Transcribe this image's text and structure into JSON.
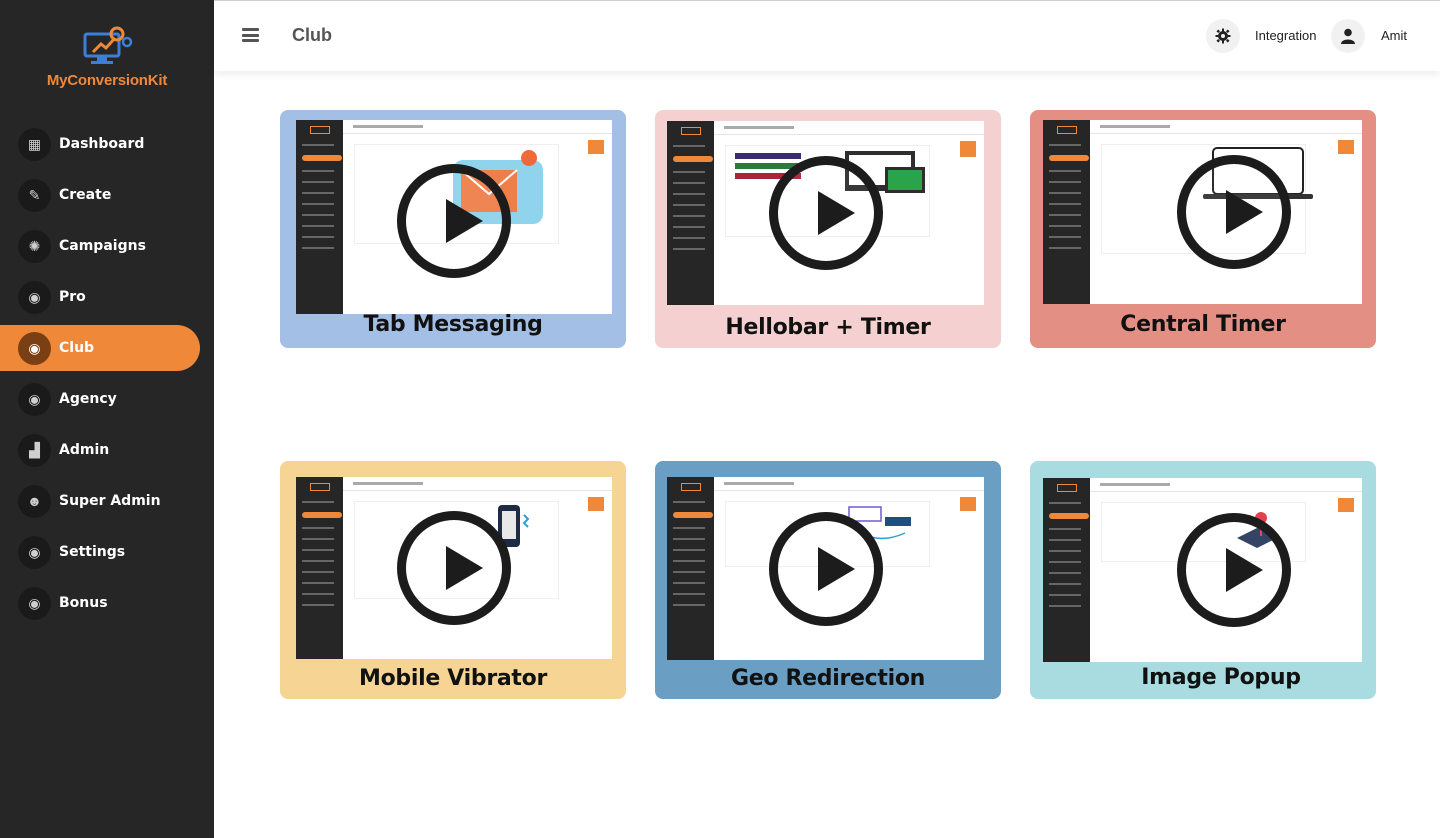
{
  "brand": {
    "name": "MyConversionKit",
    "accent": "#f0883a",
    "icon": "monitor-gears-logo"
  },
  "sidebar": {
    "items": [
      {
        "label": "Dashboard",
        "icon": "dashboard-icon"
      },
      {
        "label": "Create",
        "icon": "create-icon"
      },
      {
        "label": "Campaigns",
        "icon": "campaigns-icon"
      },
      {
        "label": "Pro",
        "icon": "pro-icon"
      },
      {
        "label": "Club",
        "icon": "club-icon",
        "active": true
      },
      {
        "label": "Agency",
        "icon": "agency-icon"
      },
      {
        "label": "Admin",
        "icon": "admin-icon"
      },
      {
        "label": "Super Admin",
        "icon": "super-admin-icon"
      },
      {
        "label": "Settings",
        "icon": "settings-icon"
      },
      {
        "label": "Bonus",
        "icon": "bonus-icon"
      }
    ]
  },
  "header": {
    "title": "Club",
    "integration_label": "Integration",
    "user_name": "Amit"
  },
  "cards": [
    {
      "title": "Tab Messaging",
      "color": "#a4bfe6"
    },
    {
      "title": "Hellobar + Timer",
      "color": "#f4d1d0"
    },
    {
      "title": "Central Timer",
      "color": "#e48f84"
    },
    {
      "title": "Mobile Vibrator",
      "color": "#f6d494"
    },
    {
      "title": "Geo Redirection",
      "color": "#6a9ec2"
    },
    {
      "title": "Image Popup",
      "color": "#a8dce0"
    }
  ]
}
